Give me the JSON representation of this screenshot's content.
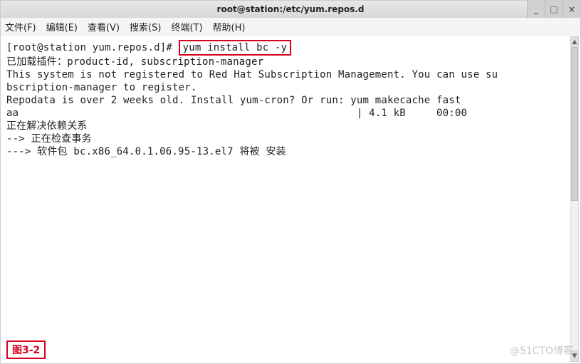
{
  "titlebar": {
    "title": "root@station:/etc/yum.repos.d"
  },
  "window_controls": {
    "min": "_",
    "max": "□",
    "close": "×"
  },
  "menubar": {
    "file": "文件(F)",
    "edit": "编辑(E)",
    "view": "查看(V)",
    "search": "搜索(S)",
    "terminal": "终端(T)",
    "help": "帮助(H)"
  },
  "terminal": {
    "prompt": "[root@station yum.repos.d]# ",
    "command": "yum install bc -y",
    "lines": {
      "l0": "已加载插件：product-id, subscription-manager",
      "l1": "This system is not registered to Red Hat Subscription Management. You can use su",
      "l2": "bscription-manager to register.",
      "l3": "Repodata is over 2 weeks old. Install yum-cron? Or run: yum makecache fast",
      "l4": "aa                                                       | 4.1 kB     00:00",
      "l5": "正在解决依赖关系",
      "l6": "--> 正在检查事务",
      "l7": "---> 软件包 bc.x86_64.0.1.06.95-13.el7 将被 安装"
    }
  },
  "figure_label": "图3-2",
  "watermark": "@51CTO博客"
}
